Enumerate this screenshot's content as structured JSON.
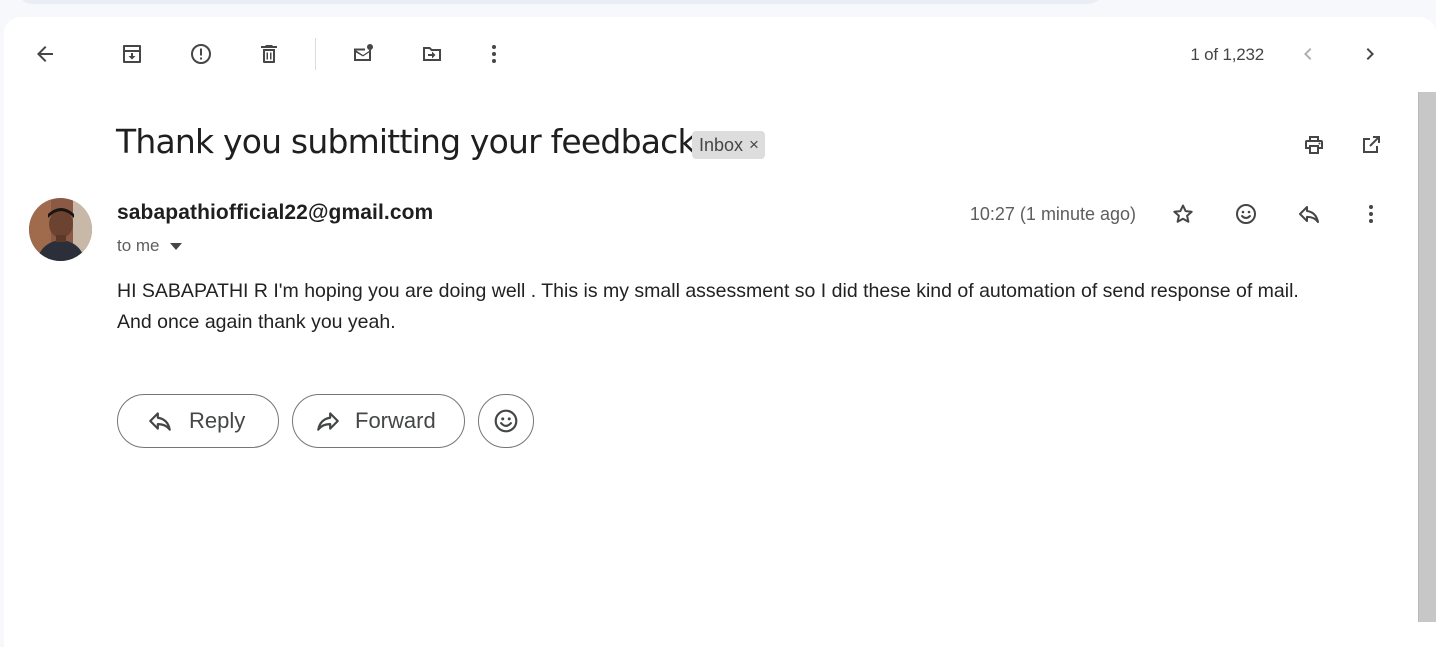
{
  "toolbar": {
    "icons": [
      "back-arrow-icon",
      "archive-icon",
      "report-spam-icon",
      "delete-icon",
      "mark-unread-icon",
      "move-to-icon",
      "more-vert-icon"
    ],
    "pager": "1 of 1,232"
  },
  "email": {
    "subject": "Thank you submitting your feedback",
    "label": "Inbox",
    "label_remove": "×",
    "sender": "sabapathiofficial22@gmail.com",
    "recipient": "to me",
    "timestamp": "10:27 (1 minute ago)",
    "body": [
      "HI SABAPATHI R I'm hoping you are doing well . This is my small assessment so I did these kind of automation of send response of mail.",
      "And once again thank you yeah."
    ]
  },
  "actions": {
    "reply_label": "Reply",
    "forward_label": "Forward"
  },
  "colors": {
    "page_bg": "#f6f8fc",
    "panel_bg": "#ffffff",
    "chip_bg": "#dddddd",
    "icon": "#444746"
  }
}
